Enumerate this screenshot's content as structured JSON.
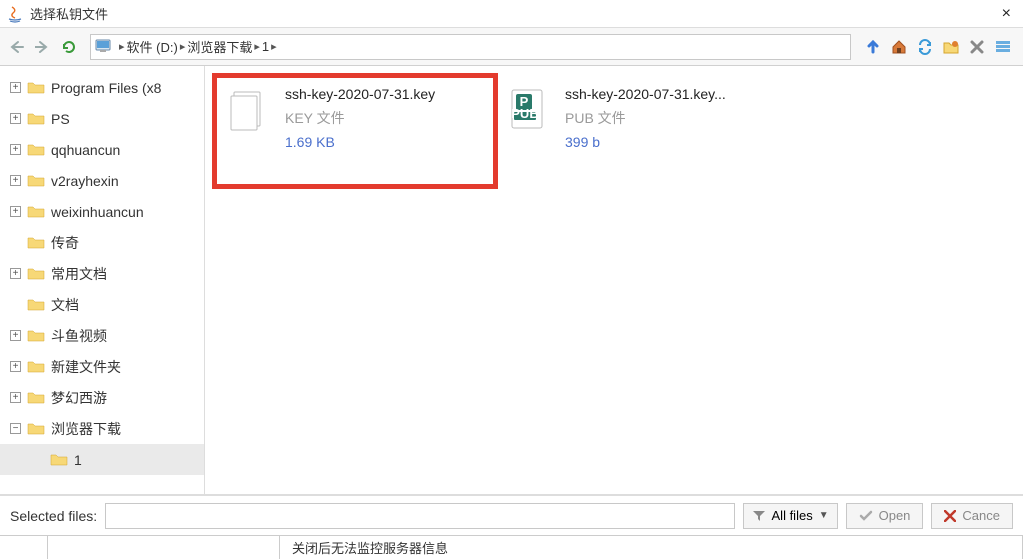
{
  "window": {
    "title": "选择私钥文件",
    "close": "×"
  },
  "breadcrumb": {
    "segments": [
      "软件 (D:)",
      "浏览器下载",
      "1"
    ]
  },
  "tree": {
    "items": [
      {
        "label": "Program Files (x8",
        "expandable": true,
        "expand_glyph": "+"
      },
      {
        "label": "PS",
        "expandable": true,
        "expand_glyph": "+"
      },
      {
        "label": "qqhuancun",
        "expandable": true,
        "expand_glyph": "+"
      },
      {
        "label": "v2rayhexin",
        "expandable": true,
        "expand_glyph": "+"
      },
      {
        "label": "weixinhuancun",
        "expandable": true,
        "expand_glyph": "+"
      },
      {
        "label": "传奇",
        "expandable": false,
        "expand_glyph": ""
      },
      {
        "label": "常用文档",
        "expandable": true,
        "expand_glyph": "+"
      },
      {
        "label": "文档",
        "expandable": false,
        "expand_glyph": ""
      },
      {
        "label": "斗鱼视频",
        "expandable": true,
        "expand_glyph": "+"
      },
      {
        "label": "新建文件夹",
        "expandable": true,
        "expand_glyph": "+"
      },
      {
        "label": "梦幻西游",
        "expandable": true,
        "expand_glyph": "+"
      },
      {
        "label": "浏览器下载",
        "expandable": true,
        "expand_glyph": "−"
      }
    ],
    "child": {
      "label": "1"
    }
  },
  "files": [
    {
      "name": "ssh-key-2020-07-31.key",
      "type": "KEY 文件",
      "size": "1.69 KB",
      "highlight": true,
      "kind": "generic"
    },
    {
      "name": "ssh-key-2020-07-31.key...",
      "type": "PUB 文件",
      "size": "399 b",
      "highlight": false,
      "kind": "pub"
    }
  ],
  "bottom": {
    "selected_label": "Selected files:",
    "selected_value": "",
    "filter_label": "All files",
    "open_label": "Open",
    "cancel_label": "Cance"
  },
  "status": {
    "seg1": "",
    "seg2": "",
    "seg3": "关闭后无法监控服务器信息"
  },
  "colors": {
    "highlight": "#e33b2e"
  }
}
